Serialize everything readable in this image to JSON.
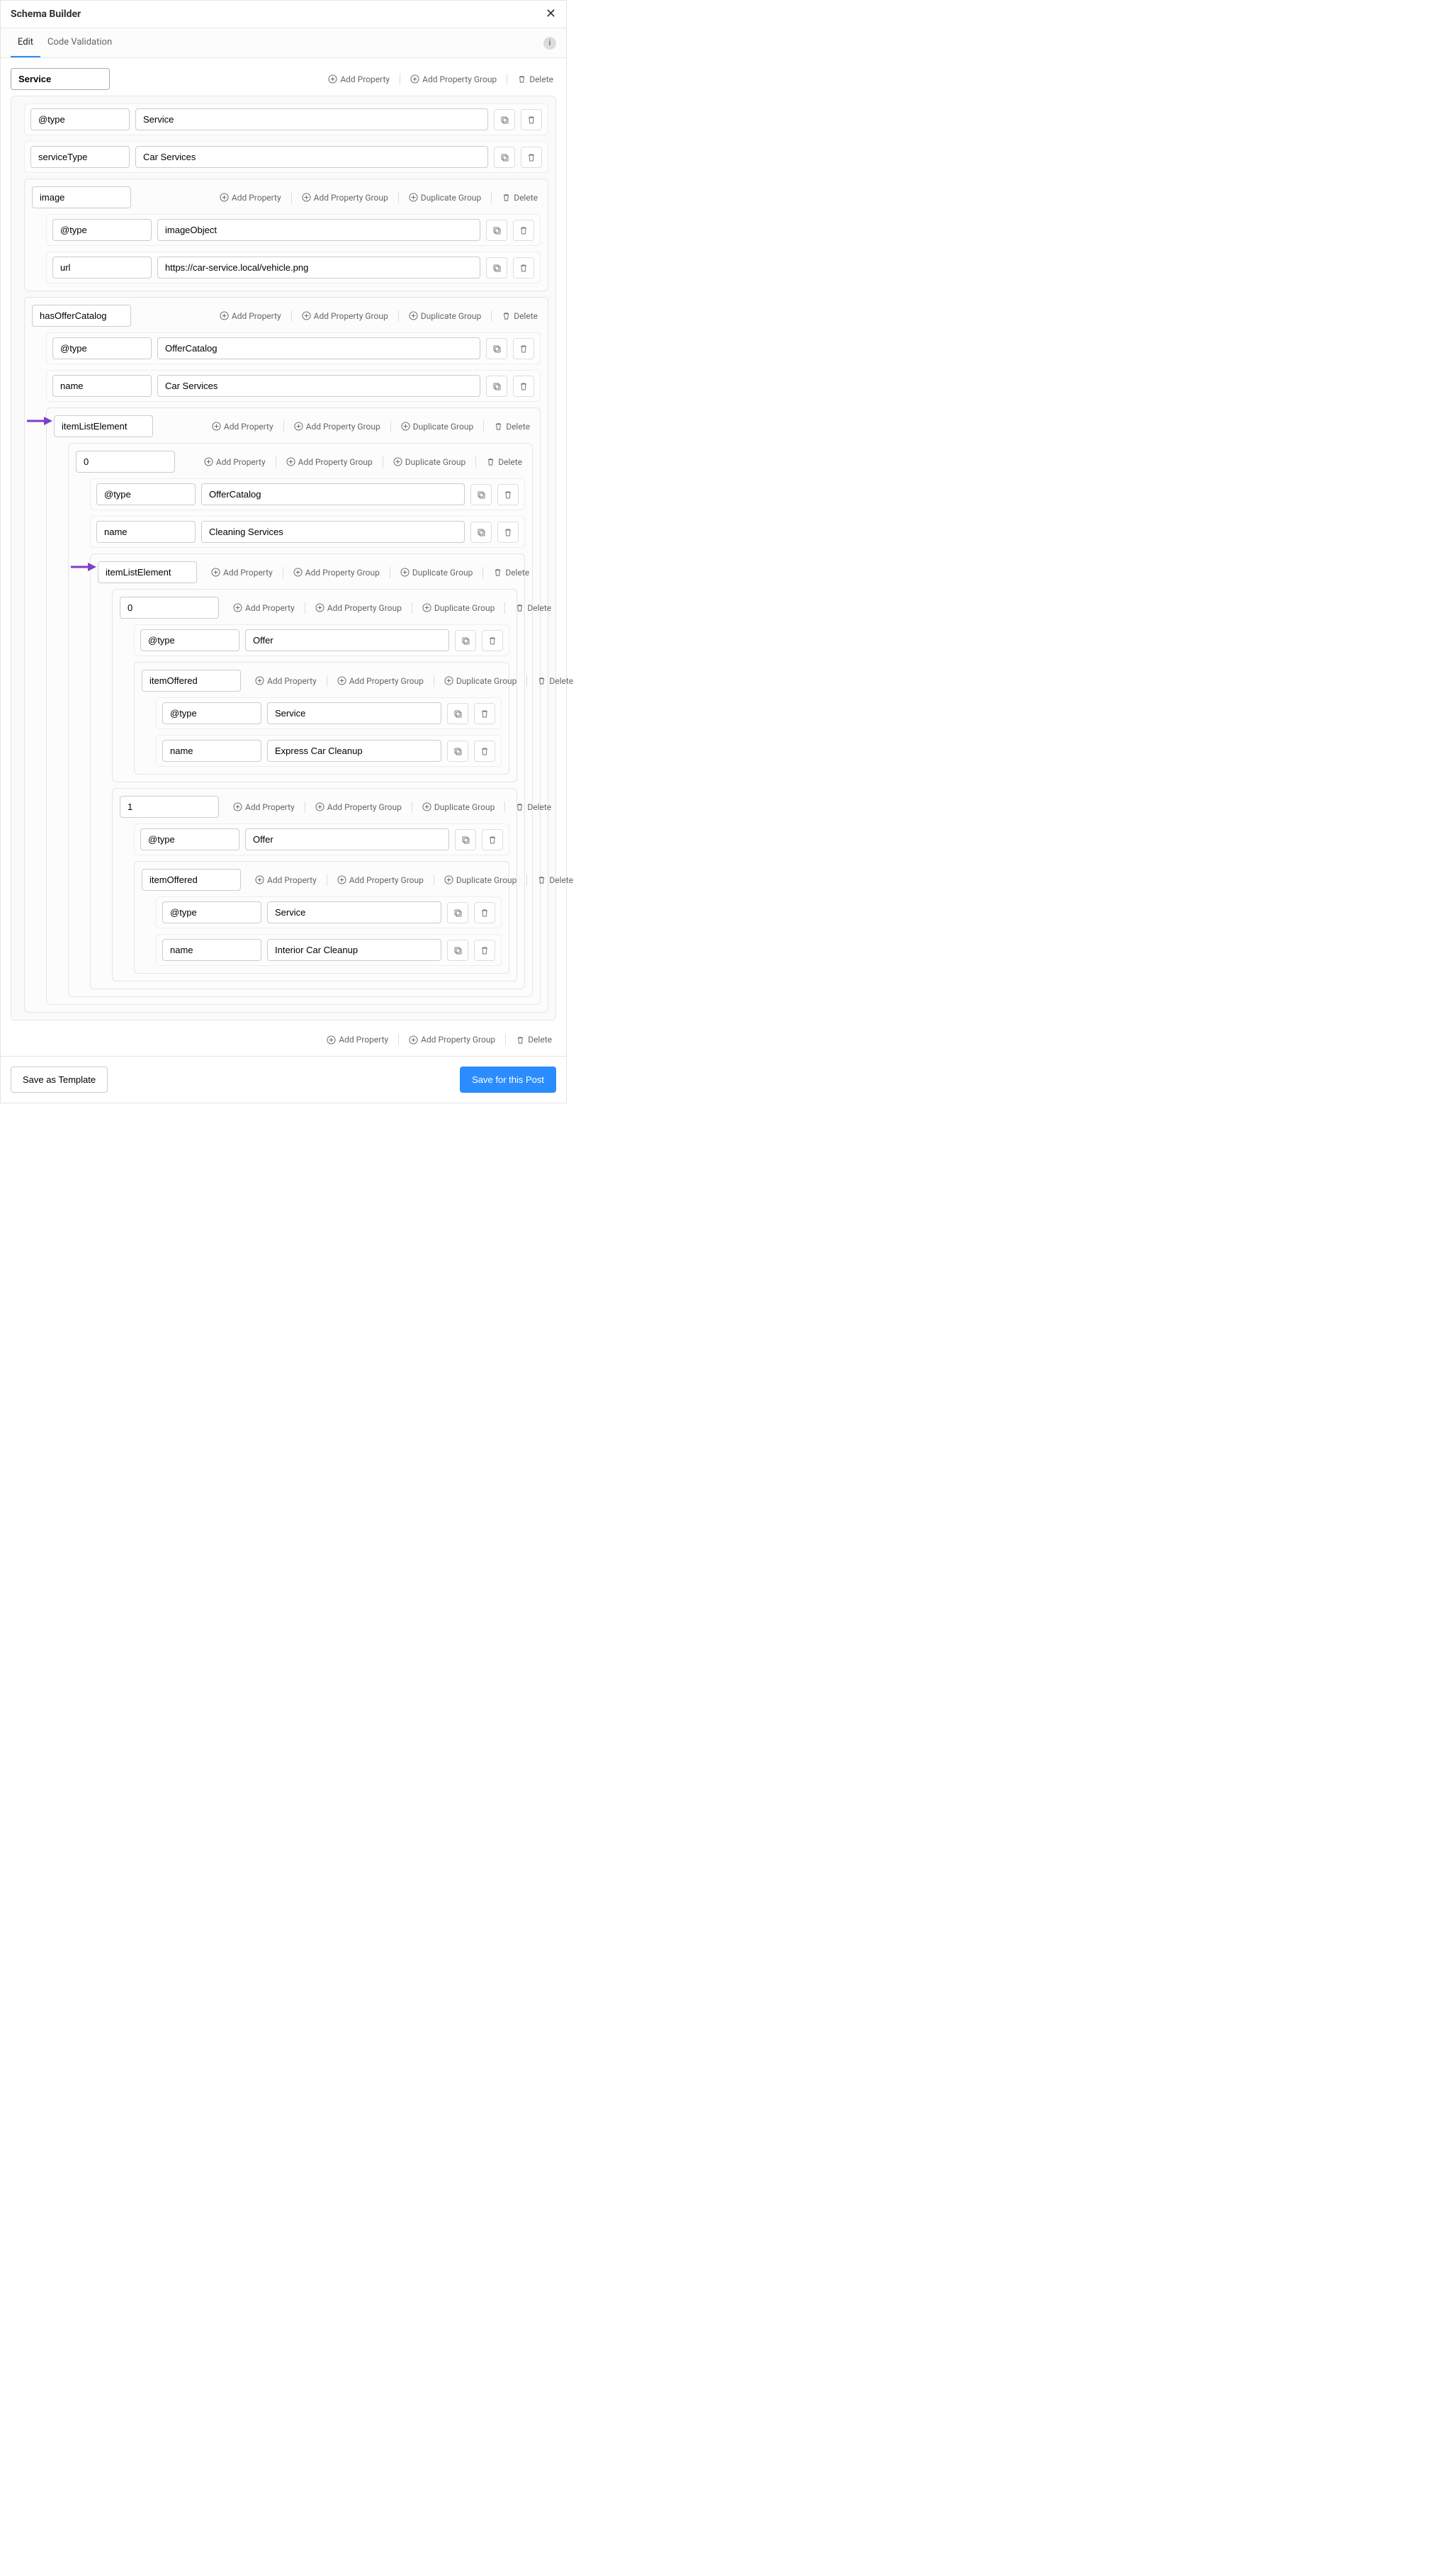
{
  "window": {
    "title": "Schema Builder"
  },
  "tabs": {
    "edit": "Edit",
    "code": "Code Validation"
  },
  "actions": {
    "addProperty": "Add Property",
    "addPropertyGroup": "Add Property Group",
    "duplicateGroup": "Duplicate Group",
    "delete": "Delete"
  },
  "buttons": {
    "saveTemplate": "Save as Template",
    "savePost": "Save for this Post"
  },
  "rootName": "Service",
  "rows": {
    "type": {
      "name": "@type",
      "value": "Service"
    },
    "serviceType": {
      "name": "serviceType",
      "value": "Car Services"
    }
  },
  "image": {
    "name": "image",
    "type": {
      "name": "@type",
      "value": "imageObject"
    },
    "url": {
      "name": "url",
      "value": "https://car-service.local/vehicle.png"
    }
  },
  "catalog": {
    "name": "hasOfferCatalog",
    "type": {
      "name": "@type",
      "value": "OfferCatalog"
    },
    "catName": {
      "name": "name",
      "value": "Car Services"
    },
    "ile": {
      "name": "itemListElement",
      "item0": {
        "name": "0",
        "type": {
          "name": "@type",
          "value": "OfferCatalog"
        },
        "itemName": {
          "name": "name",
          "value": "Cleaning Services"
        },
        "ile": {
          "name": "itemListElement",
          "i0": {
            "name": "0",
            "type": {
              "name": "@type",
              "value": "Offer"
            },
            "offered": {
              "name": "itemOffered",
              "type": {
                "name": "@type",
                "value": "Service"
              },
              "svcName": {
                "name": "name",
                "value": "Express Car Cleanup"
              }
            }
          },
          "i1": {
            "name": "1",
            "type": {
              "name": "@type",
              "value": "Offer"
            },
            "offered": {
              "name": "itemOffered",
              "type": {
                "name": "@type",
                "value": "Service"
              },
              "svcName": {
                "name": "name",
                "value": "Interior Car Cleanup"
              }
            }
          }
        }
      }
    }
  }
}
